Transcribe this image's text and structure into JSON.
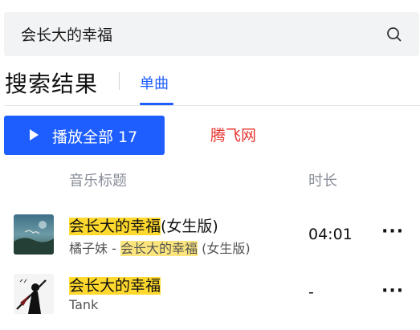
{
  "search": {
    "query": "会长大的幸福"
  },
  "header": {
    "title": "搜索结果",
    "tab_label": "单曲"
  },
  "toolbar": {
    "play_all_label": "播放全部 17"
  },
  "watermark": "腾飞网",
  "columns": {
    "title": "音乐标题",
    "duration": "时长"
  },
  "songs": [
    {
      "title_highlight": "会长大的幸福",
      "title_rest": "(女生版)",
      "artist": "橘子妹",
      "sep": " - ",
      "album_highlight": "会长大的幸福",
      "album_rest": " (女生版)",
      "duration": "04:01",
      "more": "···"
    },
    {
      "title_highlight": "会长大的幸福",
      "artist": "Tank",
      "duration": "-",
      "more": "···"
    }
  ],
  "colors": {
    "accent": "#1e5eff",
    "highlight": "#ffd92e",
    "watermark": "#e8352f"
  }
}
